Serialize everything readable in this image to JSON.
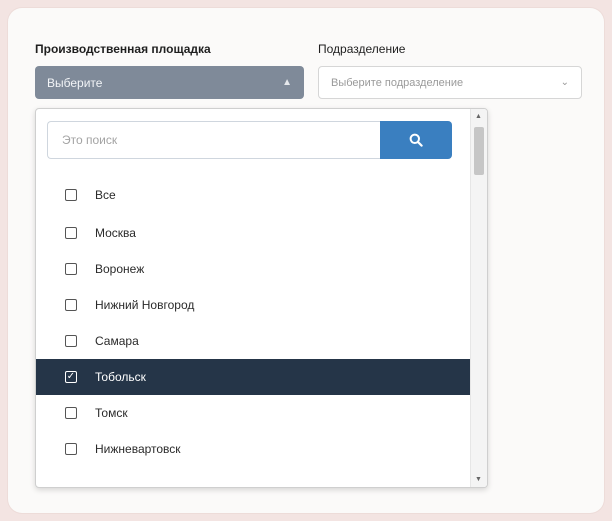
{
  "filters": {
    "site_label": "Производственная площадка",
    "division_label": "Подразделение",
    "site_select_value": "Выберите",
    "division_select_placeholder": "Выберите подразделение"
  },
  "dropdown": {
    "search_placeholder": "Это поиск",
    "search_button_icon": "search-icon",
    "items": [
      {
        "label": "Все",
        "checked": false
      },
      {
        "label": "Москва",
        "checked": false
      },
      {
        "label": "Воронеж",
        "checked": false
      },
      {
        "label": "Нижний Новгород",
        "checked": false
      },
      {
        "label": "Самара",
        "checked": false
      },
      {
        "label": "Тобольск",
        "checked": true
      },
      {
        "label": "Томск",
        "checked": false
      },
      {
        "label": "Нижневартовск",
        "checked": false
      }
    ]
  },
  "colors": {
    "primary_select_bg": "#7f8a99",
    "search_button_bg": "#3a7fc0",
    "selected_item_bg": "#253548"
  }
}
